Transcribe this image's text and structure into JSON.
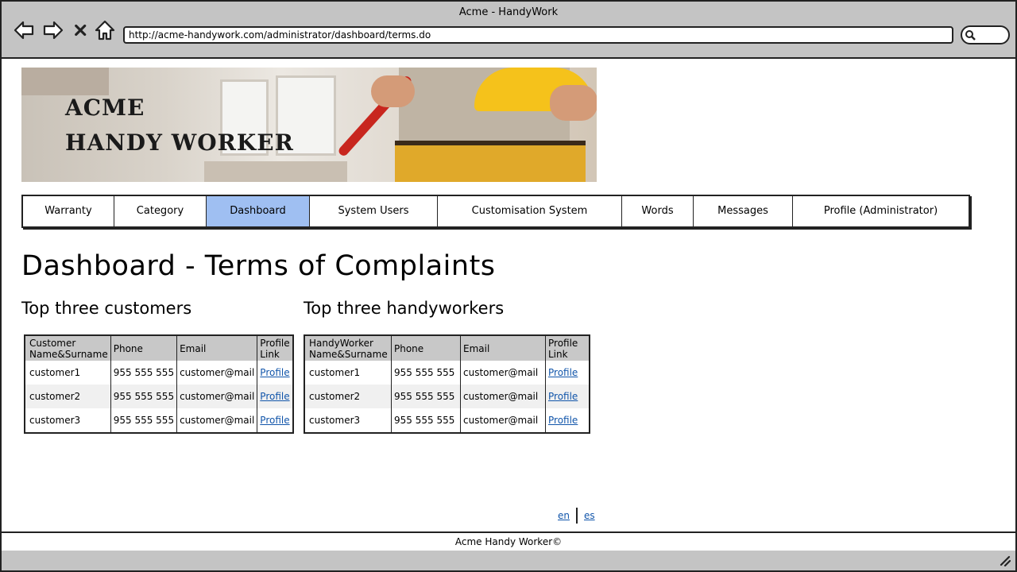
{
  "window": {
    "title": "Acme - HandyWork"
  },
  "browser": {
    "url": "http://acme-handywork.com/administrator/dashboard/terms.do"
  },
  "banner": {
    "line1": "ACME",
    "line2": "HANDY WORKER"
  },
  "menu": [
    {
      "label": "Warranty"
    },
    {
      "label": "Category"
    },
    {
      "label": "Dashboard"
    },
    {
      "label": "System Users"
    },
    {
      "label": "Customisation System"
    },
    {
      "label": "Words"
    },
    {
      "label": "Messages"
    },
    {
      "label": "Profile (Administrator)"
    }
  ],
  "page": {
    "title": "Dashboard - Terms of Complaints"
  },
  "customers": {
    "heading": "Top three customers",
    "columns": [
      "Customer Name&Surname",
      "Phone",
      "Email",
      "Profile Link"
    ],
    "rows": [
      {
        "name": "customer1",
        "phone": "955 555 555",
        "email": "customer@mail",
        "link": "Profile"
      },
      {
        "name": "customer2",
        "phone": "955 555 555",
        "email": "customer@mail",
        "link": "Profile"
      },
      {
        "name": "customer3",
        "phone": "955 555 555",
        "email": "customer@mail",
        "link": "Profile"
      }
    ]
  },
  "handyworkers": {
    "heading": "Top three handyworkers",
    "columns": [
      "HandyWorker Name&Surname",
      "Phone",
      "Email",
      "Profile Link"
    ],
    "rows": [
      {
        "name": "customer1",
        "phone": "955 555 555",
        "email": "customer@mail",
        "link": "Profile"
      },
      {
        "name": "customer2",
        "phone": "955 555 555",
        "email": "customer@mail",
        "link": "Profile"
      },
      {
        "name": "customer3",
        "phone": "955 555 555",
        "email": "customer@mail",
        "link": "Profile"
      }
    ]
  },
  "languages": {
    "en": "en",
    "es": "es"
  },
  "footer": {
    "text": "Acme Handy Worker©"
  },
  "colors": {
    "active_tab": "#9fbff2",
    "link": "#1155aa",
    "chrome": "#c4c4c4"
  },
  "icons": [
    "back-arrow-icon",
    "forward-arrow-icon",
    "close-icon",
    "home-icon",
    "search-icon",
    "resize-grip-icon"
  ]
}
